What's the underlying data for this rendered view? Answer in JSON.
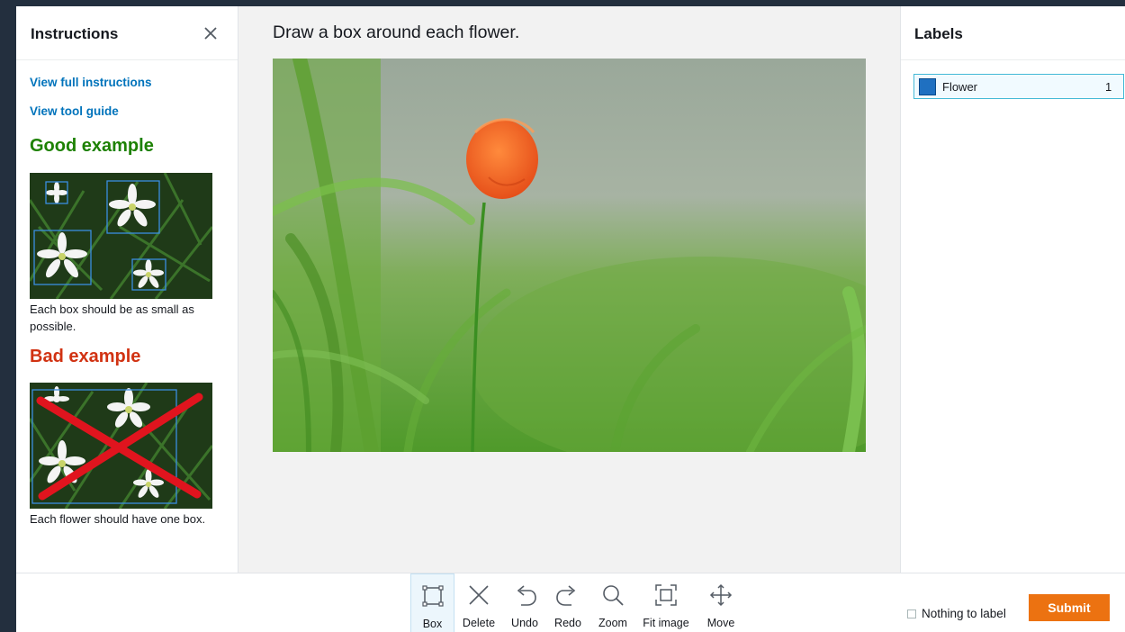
{
  "instructions": {
    "title": "Instructions",
    "close_icon": "close-icon",
    "view_full": "View full instructions",
    "view_tool_guide": "View tool guide",
    "good_heading": "Good example",
    "good_caption": "Each box should be as small as possible.",
    "bad_heading": "Bad example",
    "bad_caption": "Each flower should have one box."
  },
  "task": {
    "prompt": "Draw a box around each flower."
  },
  "labels": {
    "title": "Labels",
    "items": [
      {
        "name": "Flower",
        "count": "1",
        "color": "#1f70c1"
      }
    ]
  },
  "toolbar": {
    "tools": [
      {
        "label": "Box",
        "icon": "box-icon",
        "active": true
      },
      {
        "label": "Delete",
        "icon": "close-icon"
      },
      {
        "label": "Undo",
        "icon": "undo-icon"
      },
      {
        "label": "Redo",
        "icon": "redo-icon"
      },
      {
        "label": "Zoom",
        "icon": "zoom-icon"
      },
      {
        "label": "Fit image",
        "icon": "fit-image-icon"
      },
      {
        "label": "Move",
        "icon": "move-icon"
      }
    ],
    "nothing_to_label": "Nothing to label",
    "submit": "Submit"
  },
  "colors": {
    "accent_link": "#0073bb",
    "good": "#1d8102",
    "bad": "#d13212",
    "submit": "#ec7211"
  }
}
